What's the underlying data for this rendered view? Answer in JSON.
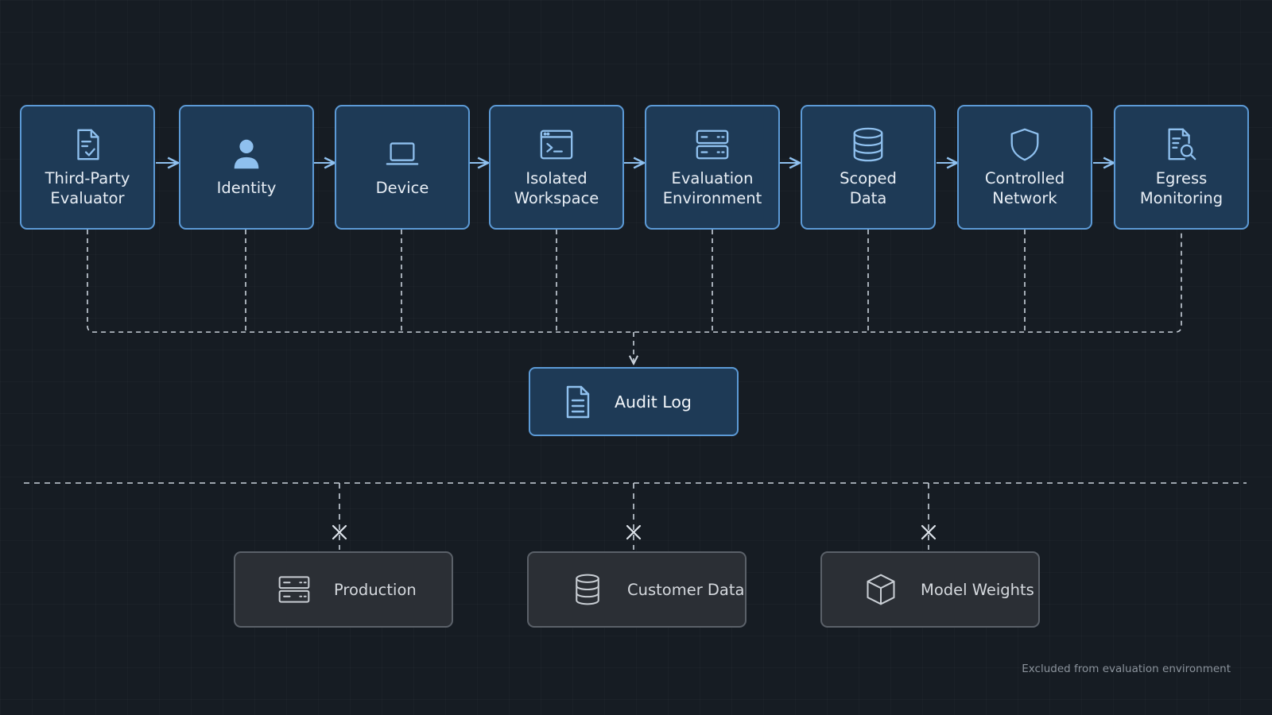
{
  "pipeline": {
    "nodes": [
      {
        "label": "Third-Party\nEvaluator",
        "icon": "checklist-document-icon"
      },
      {
        "label": "Identity",
        "icon": "user-icon"
      },
      {
        "label": "Device",
        "icon": "laptop-icon"
      },
      {
        "label": "Isolated\nWorkspace",
        "icon": "terminal-window-icon"
      },
      {
        "label": "Evaluation\nEnvironment",
        "icon": "server-icon"
      },
      {
        "label": "Scoped\nData",
        "icon": "database-icon"
      },
      {
        "label": "Controlled\nNetwork",
        "icon": "shield-icon"
      },
      {
        "label": "Egress\nMonitoring",
        "icon": "document-search-icon"
      }
    ]
  },
  "audit_log": {
    "label": "Audit Log",
    "icon": "document-icon"
  },
  "excluded": {
    "items": [
      {
        "label": "Production",
        "icon": "server-icon"
      },
      {
        "label": "Customer Data",
        "icon": "database-icon"
      },
      {
        "label": "Model Weights",
        "icon": "cube-icon"
      }
    ],
    "note": "Excluded from evaluation environment"
  },
  "colors": {
    "background": "#161c23",
    "node_fill": "#1e3a56",
    "node_border": "#5c9ad6",
    "connector": "#c9d1da",
    "accent_icon": "#8fc0ee",
    "excluded_fill": "#2b2f35",
    "excluded_border": "#5b6169"
  }
}
